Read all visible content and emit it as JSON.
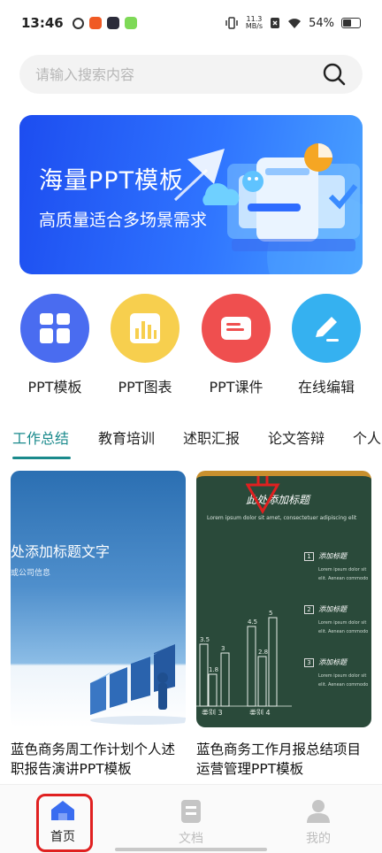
{
  "status_bar": {
    "time": "13:46",
    "net_speed_value": "11.3",
    "net_speed_unit": "MB/s",
    "battery": "54%",
    "battery_level": 0.54
  },
  "search": {
    "placeholder": "请输入搜索内容"
  },
  "banner": {
    "title": "海量PPT模板",
    "subtitle": "高质量适合多场景需求"
  },
  "categories": [
    {
      "label": "PPT模板",
      "color": "#4a6cf0",
      "icon": "grid-icon"
    },
    {
      "label": "PPT图表",
      "color": "#f7cf4e",
      "icon": "bar-chart-icon"
    },
    {
      "label": "PPT课件",
      "color": "#ef4f4f",
      "icon": "document-icon"
    },
    {
      "label": "在线编辑",
      "color": "#35b1f0",
      "icon": "edit-icon"
    }
  ],
  "tabs": [
    {
      "label": "工作总结",
      "active": true
    },
    {
      "label": "教育培训",
      "active": false
    },
    {
      "label": "述职汇报",
      "active": false
    },
    {
      "label": "论文答辩",
      "active": false
    },
    {
      "label": "个人",
      "active": false
    }
  ],
  "cards": [
    {
      "title": "蓝色商务周工作计划个人述职报告演讲PPT模板",
      "thumb_heading": "处添加标题文字",
      "thumb_sub": "或公司信息"
    },
    {
      "title": "蓝色商务工作月报总结项目运营管理PPT模板",
      "thumb_heading": "此处添加标题",
      "thumb_sub": "Lorem ipsum dolor sit amet, consectetuer adipiscing elit",
      "bar_labels": [
        "3.5",
        "1.8",
        "3",
        "4.5",
        "2.8",
        "5"
      ],
      "bar_values": [
        3.5,
        1.8,
        3,
        4.5,
        2.8,
        5
      ],
      "cat_labels": [
        "类别 3",
        "类别 4"
      ],
      "items": [
        {
          "num": "1",
          "heading": "添加标题",
          "text1": "Lorem ipsum dolor sit",
          "text2": "elit. Aenean commodo"
        },
        {
          "num": "2",
          "heading": "添加标题",
          "text1": "Lorem ipsum dolor sit",
          "text2": "elit. Aenean commodo"
        },
        {
          "num": "3",
          "heading": "添加标题",
          "text1": "Lorem ipsum dolor sit",
          "text2": "elit. Aenean commodo"
        }
      ]
    }
  ],
  "bottom_nav": [
    {
      "label": "首页",
      "active": true,
      "color": "#3a6df0"
    },
    {
      "label": "文档",
      "active": false,
      "color": "#c5c5c5"
    },
    {
      "label": "我的",
      "active": false,
      "color": "#c5c5c5"
    }
  ],
  "colors": {
    "accent": "#1a8a8c",
    "highlight": "#e02020"
  }
}
